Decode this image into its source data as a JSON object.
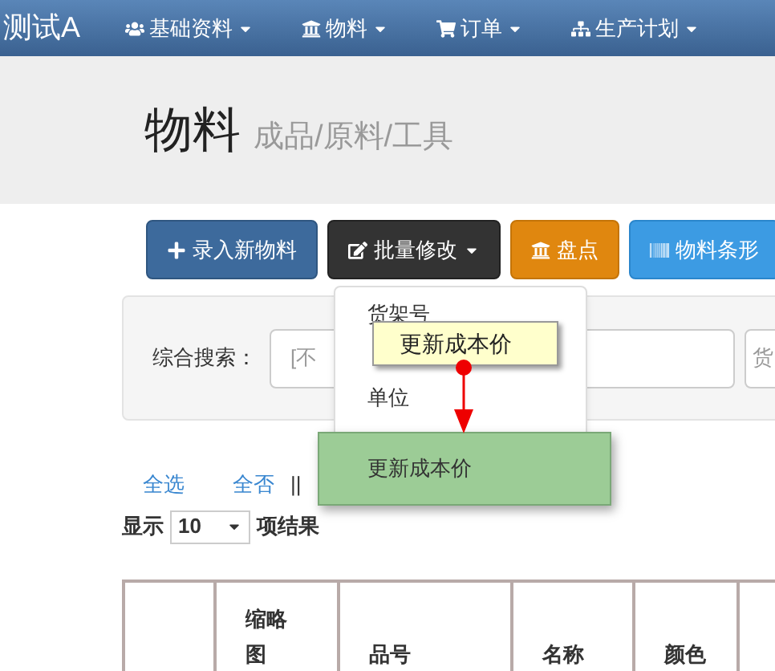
{
  "navbar": {
    "brand": "测试A",
    "items": [
      {
        "label": "基础资料"
      },
      {
        "label": "物料"
      },
      {
        "label": "订单"
      },
      {
        "label": "生产计划"
      }
    ]
  },
  "header": {
    "title": "物料",
    "subtitle": "成品/原料/工具"
  },
  "toolbar": [
    {
      "label": "录入新物料",
      "kind": "primary"
    },
    {
      "label": "批量修改",
      "kind": "dark"
    },
    {
      "label": "盘点",
      "kind": "warning"
    },
    {
      "label": "物料条形",
      "kind": "info"
    }
  ],
  "search": {
    "label": "综合搜索：",
    "first_field": "[不",
    "third_field": "货"
  },
  "dropdown": {
    "items": [
      {
        "label": "货架号",
        "selected": false
      },
      {
        "label": "单位",
        "selected": false
      }
    ],
    "highlight": {
      "label": "更新成本价"
    }
  },
  "tooltip": {
    "text": "更新成本价"
  },
  "links": [
    "全选",
    "全否"
  ],
  "separator": "||",
  "page_size": {
    "prefix": "显示",
    "value": "10",
    "suffix": "项结果"
  },
  "table": {
    "columns": [
      "",
      "缩略图",
      "品号",
      "名称",
      "颜色"
    ]
  }
}
